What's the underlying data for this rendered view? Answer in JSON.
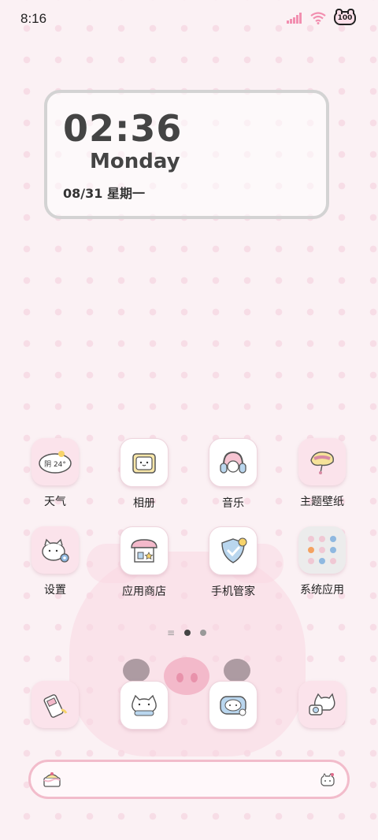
{
  "status": {
    "time": "8:16",
    "battery": "100"
  },
  "clock": {
    "time": "02:36",
    "day": "Monday",
    "date": "08/31  星期一"
  },
  "weather_icon_text": "阴 24°",
  "apps_row1": [
    {
      "label": "天气"
    },
    {
      "label": "相册"
    },
    {
      "label": "音乐"
    },
    {
      "label": "主题壁纸"
    }
  ],
  "apps_row2": [
    {
      "label": "设置"
    },
    {
      "label": "应用商店"
    },
    {
      "label": "手机管家"
    },
    {
      "label": "系统应用"
    }
  ],
  "colors": {
    "accent": "#f2bccb",
    "background": "#fbf1f4"
  }
}
